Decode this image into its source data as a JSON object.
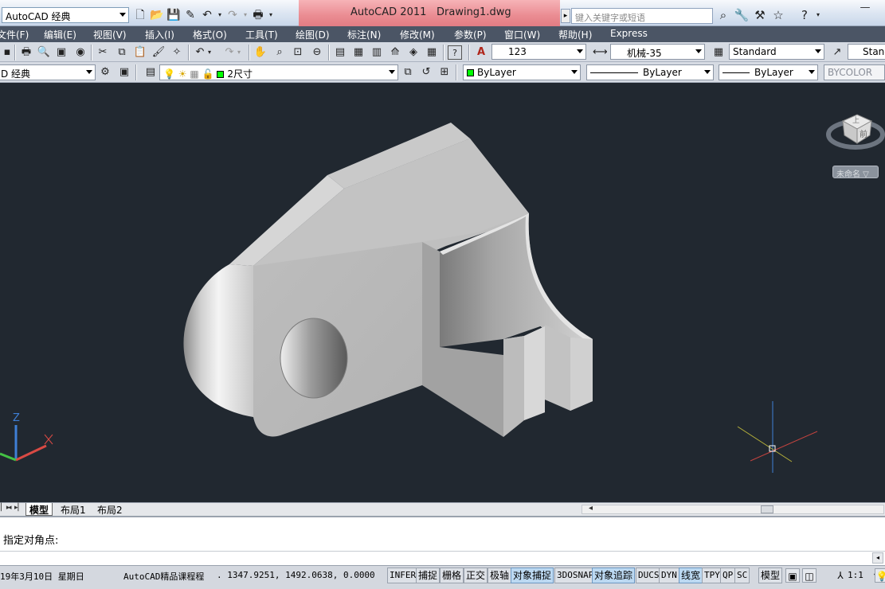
{
  "app": {
    "title": "AutoCAD 2011",
    "document": "Drawing1.dwg",
    "workspace": "AutoCAD 经典",
    "search_placeholder": "键入关键字或短语"
  },
  "menu": [
    "文件(F)",
    "编辑(E)",
    "视图(V)",
    "插入(I)",
    "格式(O)",
    "工具(T)",
    "绘图(D)",
    "标注(N)",
    "修改(M)",
    "参数(P)",
    "窗口(W)",
    "帮助(H)",
    "Express"
  ],
  "styles_toolbar": {
    "text_style": "123",
    "dim_style": "机械-35",
    "table_style": "Standard",
    "multileader_style": "Standard"
  },
  "layers_toolbar": {
    "workspace_short": "D 经典",
    "current_layer": "2尺寸",
    "color": "ByLayer",
    "linetype": "ByLayer",
    "lineweight": "ByLayer",
    "plotstyle": "BYCOLOR"
  },
  "viewcube": {
    "face_label": "前",
    "top_label": "上",
    "ucs_label": "未命名"
  },
  "ucs_icon": {
    "z_label": "Z"
  },
  "layout_tabs": [
    "模型",
    "布局1",
    "布局2"
  ],
  "command": {
    "prompt": "指定对角点:"
  },
  "statusbar": {
    "date": "19年3月10日 星期日",
    "course": "AutoCAD精品课程程",
    "coordinates": "1347.9251, 1492.0638, 0.0000",
    "toggles": [
      {
        "label": "INFER",
        "on": false
      },
      {
        "label": "捕捉",
        "on": false
      },
      {
        "label": "栅格",
        "on": false
      },
      {
        "label": "正交",
        "on": false
      },
      {
        "label": "极轴",
        "on": false
      },
      {
        "label": "对象捕捉",
        "on": true
      },
      {
        "label": "3DOSNAP",
        "on": false
      },
      {
        "label": "对象追踪",
        "on": true
      },
      {
        "label": "DUCS",
        "on": false
      },
      {
        "label": "DYN",
        "on": false
      },
      {
        "label": "线宽",
        "on": true
      },
      {
        "label": "TPY",
        "on": false
      },
      {
        "label": "QP",
        "on": false
      },
      {
        "label": "SC",
        "on": false
      }
    ],
    "model_label": "模型",
    "scale": "1:1"
  },
  "colors": {
    "viewport_bg": "#212830",
    "menubar_bg": "#4b5565",
    "title_accent": "#e27c83"
  }
}
